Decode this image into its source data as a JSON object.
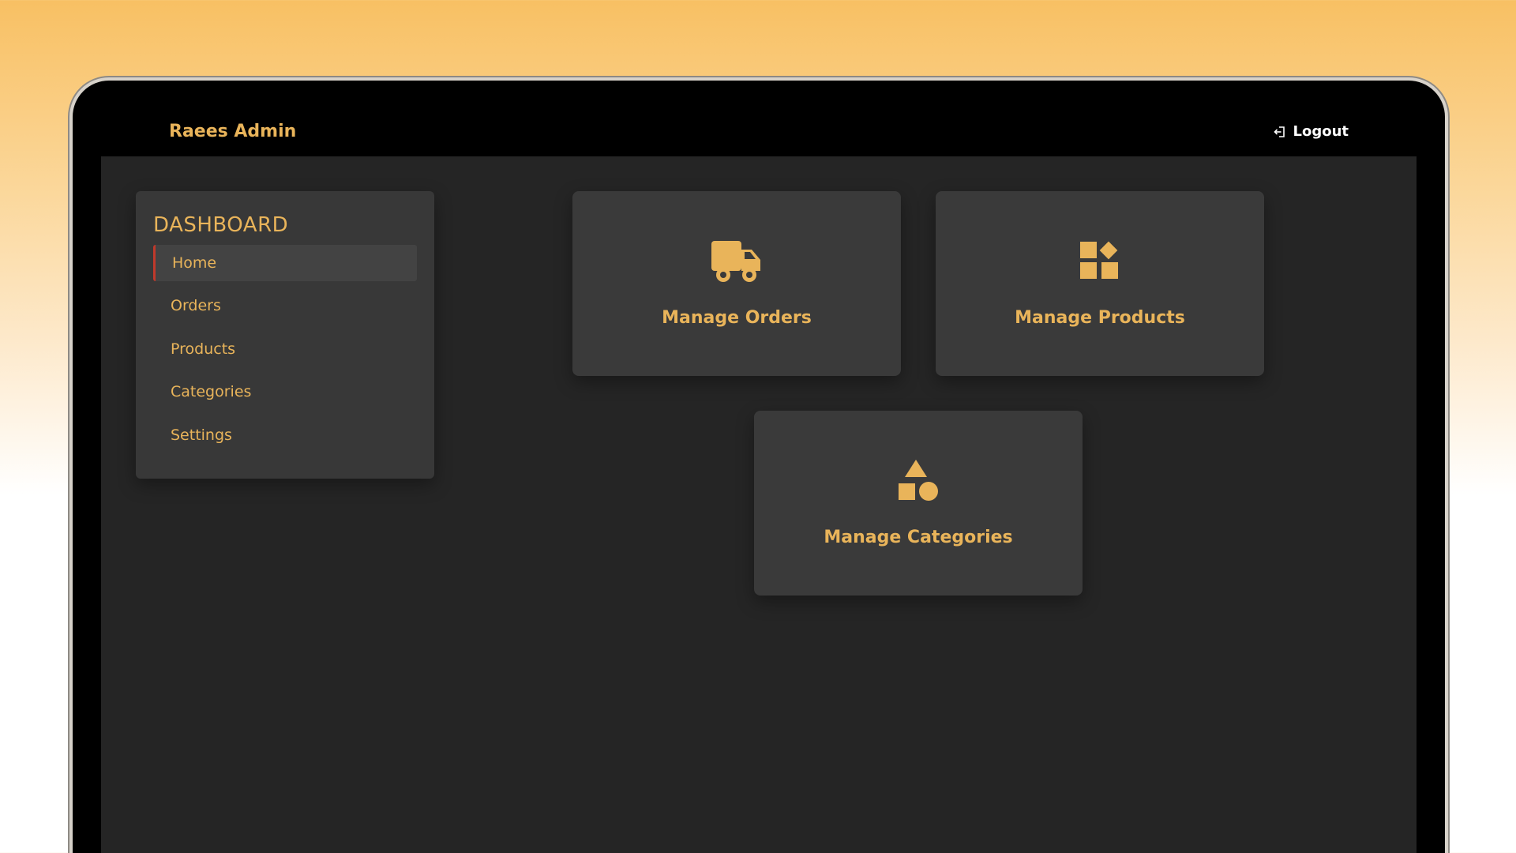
{
  "header": {
    "brand": "Raees Admin",
    "logout_label": "Logout",
    "logout_icon": "logout-icon"
  },
  "sidebar": {
    "title": "DASHBOARD",
    "items": [
      {
        "label": "Home",
        "active": true
      },
      {
        "label": "Orders",
        "active": false
      },
      {
        "label": "Products",
        "active": false
      },
      {
        "label": "Categories",
        "active": false
      },
      {
        "label": "Settings",
        "active": false
      }
    ]
  },
  "cards": [
    {
      "label": "Manage Orders",
      "icon": "truck-icon"
    },
    {
      "label": "Manage Products",
      "icon": "products-grid-icon"
    },
    {
      "label": "Manage Categories",
      "icon": "shapes-icon"
    }
  ],
  "colors": {
    "accent": "#e9b45a",
    "active_marker": "#c0392b",
    "panel": "#383838",
    "background": "#252525",
    "topbar": "#000000"
  }
}
